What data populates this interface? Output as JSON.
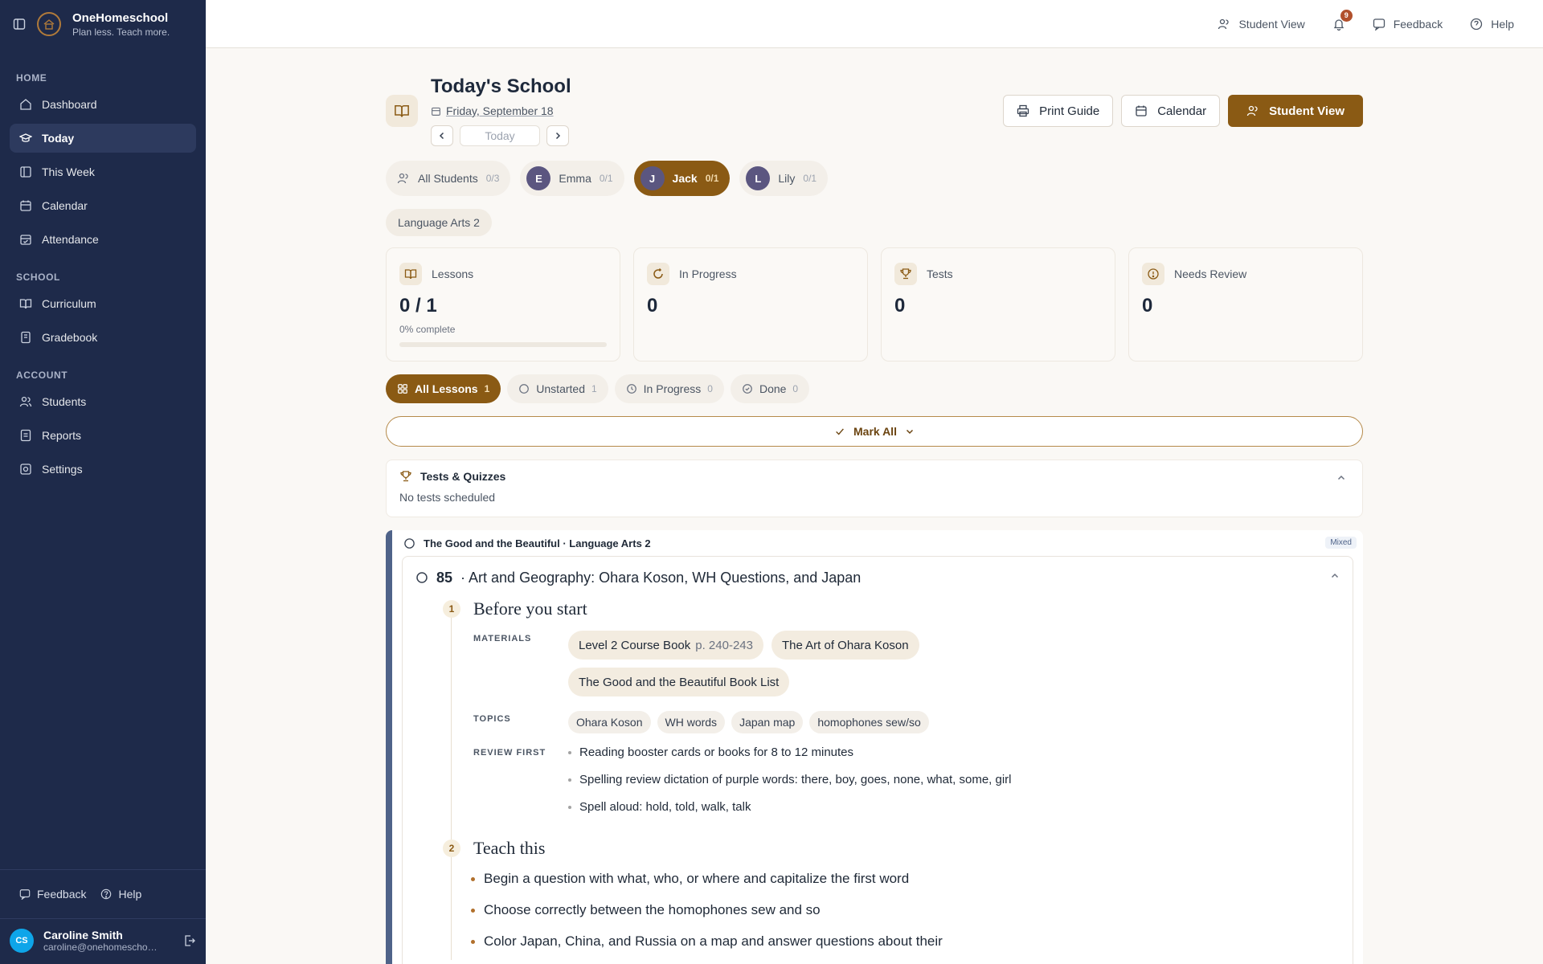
{
  "brand": {
    "name": "OneHomeschool",
    "tagline": "Plan less. Teach more."
  },
  "sidebar": {
    "sections": [
      {
        "title": "HOME",
        "items": [
          "Dashboard",
          "Today",
          "This Week",
          "Calendar",
          "Attendance"
        ]
      },
      {
        "title": "SCHOOL",
        "items": [
          "Curriculum",
          "Gradebook"
        ]
      },
      {
        "title": "ACCOUNT",
        "items": [
          "Students",
          "Reports",
          "Settings"
        ]
      }
    ],
    "active": "Today",
    "feedback": "Feedback",
    "help": "Help",
    "user": {
      "initials": "CS",
      "name": "Caroline Smith",
      "email": "caroline@onehomeschool.com"
    }
  },
  "topbar": {
    "student_view": "Student View",
    "notifications": "9",
    "feedback": "Feedback",
    "help": "Help"
  },
  "header": {
    "title": "Today's School",
    "date": "Friday, September 18",
    "today_label": "Today",
    "print_guide": "Print Guide",
    "calendar": "Calendar",
    "student_view": "Student View"
  },
  "students": [
    {
      "name": "All Students",
      "count": "0/3",
      "initial": ""
    },
    {
      "name": "Emma",
      "count": "0/1",
      "initial": "E"
    },
    {
      "name": "Jack",
      "count": "0/1",
      "initial": "J"
    },
    {
      "name": "Lily",
      "count": "0/1",
      "initial": "L"
    }
  ],
  "active_student": "Jack",
  "subject": "Language Arts 2",
  "stats": {
    "lessons": {
      "label": "Lessons",
      "value": "0 / 1",
      "sub": "0% complete",
      "progress": 0
    },
    "in_progress": {
      "label": "In Progress",
      "value": "0"
    },
    "tests": {
      "label": "Tests",
      "value": "0"
    },
    "needs_review": {
      "label": "Needs Review",
      "value": "0"
    }
  },
  "filters": [
    {
      "label": "All Lessons",
      "count": "1"
    },
    {
      "label": "Unstarted",
      "count": "1"
    },
    {
      "label": "In Progress",
      "count": "0"
    },
    {
      "label": "Done",
      "count": "0"
    }
  ],
  "mark_all": "Mark All",
  "tests": {
    "title": "Tests & Quizzes",
    "empty": "No tests scheduled"
  },
  "course": {
    "title": "The Good and the Beautiful · Language Arts 2",
    "badge": "Mixed",
    "lesson": {
      "number": "85",
      "title": "· Art and Geography: Ohara Koson, WH Questions, and Japan",
      "step1": {
        "num": "1",
        "title": "Before you start",
        "materials_label": "MATERIALS",
        "materials": [
          {
            "name": "Level 2 Course Book",
            "pages": "p. 240-243"
          },
          {
            "name": "The Art of Ohara Koson",
            "pages": ""
          },
          {
            "name": "The Good and the Beautiful Book List",
            "pages": ""
          }
        ],
        "topics_label": "TOPICS",
        "topics": [
          "Ohara Koson",
          "WH words",
          "Japan map",
          "homophones sew/so"
        ],
        "review_label": "REVIEW FIRST",
        "review": [
          "Reading booster cards or books for 8 to 12 minutes",
          "Spelling review dictation of purple words: there, boy, goes, none, what, some, girl",
          "Spell aloud: hold, told, walk, talk"
        ]
      },
      "step2": {
        "num": "2",
        "title": "Teach this",
        "items": [
          "Begin a question with what, who, or where and capitalize the first word",
          "Choose correctly between the homophones sew and so",
          "Color Japan, China, and Russia on a map and answer questions about their"
        ]
      }
    }
  },
  "colors": {
    "sidebar": "#1e2a4a",
    "accent": "#8a5a14",
    "course_bar": "#4f6389"
  }
}
